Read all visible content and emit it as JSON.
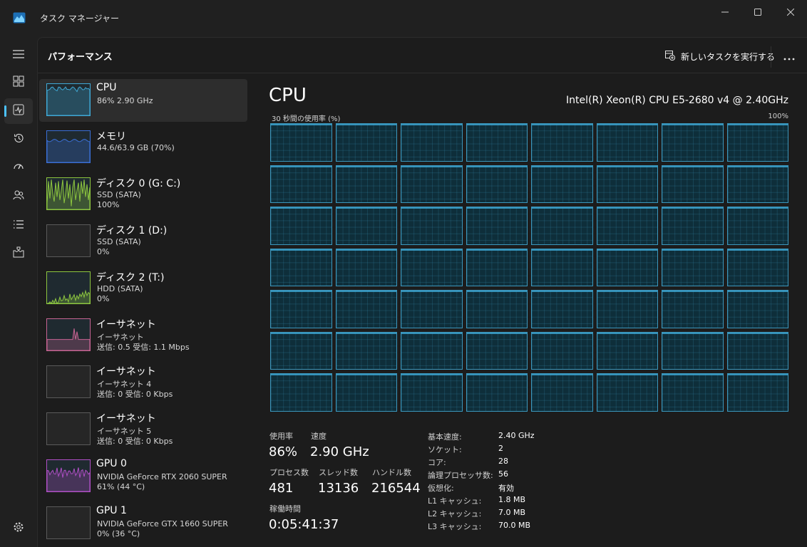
{
  "window": {
    "title": "タスク マネージャー"
  },
  "header": {
    "page_title": "パフォーマンス",
    "new_task_label": "新しいタスクを実行する"
  },
  "nav": [
    {
      "icon": "hamburger-menu-icon"
    },
    {
      "icon": "processes-icon"
    },
    {
      "icon": "performance-icon",
      "active": true
    },
    {
      "icon": "app-history-icon"
    },
    {
      "icon": "startup-apps-icon"
    },
    {
      "icon": "users-icon"
    },
    {
      "icon": "details-icon"
    },
    {
      "icon": "services-icon"
    },
    {
      "icon": "settings-icon"
    }
  ],
  "resources": [
    {
      "name": "CPU",
      "sub1": "86%  2.90 GHz",
      "sub2": "",
      "selected": true,
      "graph": "cpu",
      "color": "#3fa9d6",
      "level": 0.86
    },
    {
      "name": "メモリ",
      "sub1": "44.6/63.9 GB (70%)",
      "sub2": "",
      "graph": "memory",
      "color": "#3a6fd6",
      "level": 0.7
    },
    {
      "name": "ディスク 0 (G: C:)",
      "sub1": "SSD (SATA)",
      "sub2": "100%",
      "graph": "disk",
      "color": "#8dc63f",
      "level": 1.0
    },
    {
      "name": "ディスク 1 (D:)",
      "sub1": "SSD (SATA)",
      "sub2": "0%",
      "graph": "empty",
      "color": "#8dc63f",
      "level": 0
    },
    {
      "name": "ディスク 2 (T:)",
      "sub1": "HDD (SATA)",
      "sub2": "0%",
      "graph": "disk-low",
      "color": "#8dc63f",
      "level": 0
    },
    {
      "name": "イーサネット",
      "sub1": "イーサネット",
      "sub2": "送信: 0.5 受信: 1.1 Mbps",
      "graph": "net",
      "color": "#c86493",
      "level": 0.1
    },
    {
      "name": "イーサネット",
      "sub1": "イーサネット 4",
      "sub2": "送信: 0 受信: 0 Kbps",
      "graph": "empty",
      "color": "#c86493",
      "level": 0
    },
    {
      "name": "イーサネット",
      "sub1": "イーサネット 5",
      "sub2": "送信: 0 受信: 0 Kbps",
      "graph": "empty",
      "color": "#c86493",
      "level": 0
    },
    {
      "name": "GPU 0",
      "sub1": "NVIDIA GeForce RTX 2060 SUPER",
      "sub2": "61%  (44 °C)",
      "graph": "gpu",
      "color": "#b04fc6",
      "level": 0.61
    },
    {
      "name": "GPU 1",
      "sub1": "NVIDIA GeForce GTX 1660 SUPER",
      "sub2": "0%  (36 °C)",
      "graph": "empty",
      "color": "#b04fc6",
      "level": 0
    }
  ],
  "cpu": {
    "heading": "CPU",
    "model": "Intel(R) Xeon(R) CPU E5-2680 v4 @ 2.40GHz",
    "graph_label": "30 秒間の使用率 (%)",
    "graph_max": "100%",
    "logical_cores": 56,
    "stats": {
      "utilization_label": "使用率",
      "utilization": "86%",
      "speed_label": "速度",
      "speed": "2.90 GHz",
      "processes_label": "プロセス数",
      "processes": "481",
      "threads_label": "スレッド数",
      "threads": "13136",
      "handles_label": "ハンドル数",
      "handles": "216544",
      "uptime_label": "稼働時間",
      "uptime": "0:05:41:37"
    },
    "specs": [
      {
        "label": "基本速度:",
        "value": "2.40 GHz"
      },
      {
        "label": "ソケット:",
        "value": "2"
      },
      {
        "label": "コア:",
        "value": "28"
      },
      {
        "label": "論理プロセッサ数:",
        "value": "56"
      },
      {
        "label": "仮想化:",
        "value": "有効"
      },
      {
        "label": "L1 キャッシュ:",
        "value": "1.8 MB"
      },
      {
        "label": "L2 キャッシュ:",
        "value": "7.0 MB"
      },
      {
        "label": "L3 キャッシュ:",
        "value": "70.0 MB"
      }
    ]
  },
  "colors": {
    "accent": "#4cc2ff",
    "cpu": "#3fa9d6",
    "memory": "#3a6fd6",
    "disk": "#8dc63f",
    "ethernet": "#c86493",
    "gpu": "#b04fc6"
  }
}
